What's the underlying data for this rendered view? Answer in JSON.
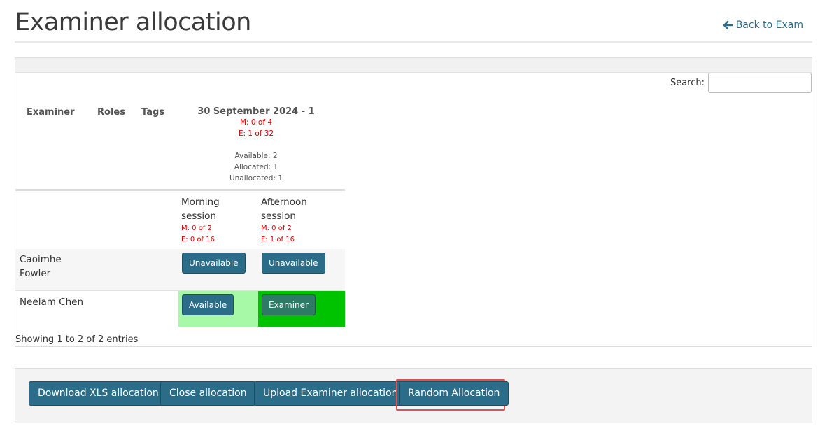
{
  "page": {
    "title": "Examiner allocation",
    "back_link": "Back to Exam",
    "back_icon": "arrow-left-icon"
  },
  "search": {
    "label": "Search:",
    "value": "",
    "placeholder": ""
  },
  "table": {
    "columns": [
      "Examiner",
      "Roles",
      "Tags"
    ],
    "date": {
      "title": "30 September 2024 - 1",
      "m_count": "M: 0 of 4",
      "e_count": "E: 1 of 32",
      "available": "Available: 2",
      "allocated": "Allocated: 1",
      "unallocated": "Unallocated: 1"
    },
    "sessions": [
      {
        "line1": "Morning",
        "line2": "session",
        "m_count": "M: 0 of 2",
        "e_count": "E: 0 of 16"
      },
      {
        "line1": "Afternoon",
        "line2": "session",
        "m_count": "M: 0 of 2",
        "e_count": "E: 1 of 16"
      }
    ],
    "rows": [
      {
        "name_line1": "Caoimhe",
        "name_line2": "Fowler",
        "morning": "Unavailable",
        "afternoon": "Unavailable"
      },
      {
        "name_line1": "Neelam Chen",
        "morning": "Available",
        "afternoon": "Examiner"
      }
    ],
    "footer_info": "Showing 1 to 2 of 2 entries"
  },
  "actions": {
    "download": "Download XLS allocation",
    "close": "Close allocation",
    "upload": "Upload Examiner allocation",
    "random": "Random Allocation"
  },
  "colors": {
    "primary_button": "#2b6d89",
    "available_cell": "#a7f9a7",
    "examiner_cell": "#00c300",
    "count_text": "#dd0000",
    "highlight_border": "#e05050"
  }
}
